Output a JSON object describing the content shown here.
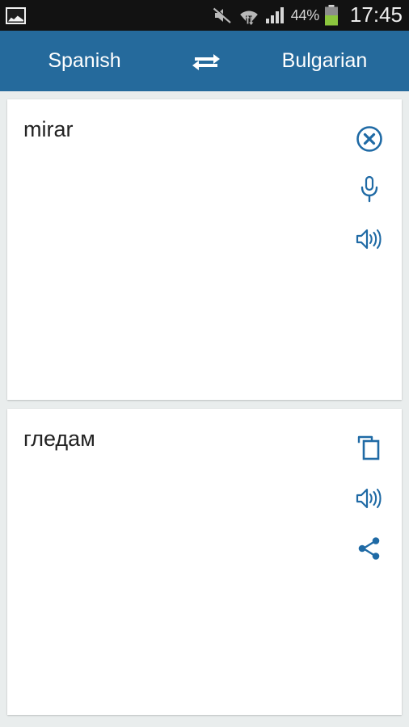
{
  "status_bar": {
    "left_icons": [
      {
        "name": "gallery-image-icon",
        "label": "image"
      }
    ],
    "right_icons": [
      {
        "name": "sound-muted-icon",
        "label": "mute"
      },
      {
        "name": "wifi-icon",
        "label": "wifi"
      },
      {
        "name": "cellular-signal-icon",
        "label": "signal"
      }
    ],
    "battery_percent": "44%",
    "battery_level": 44,
    "clock": "17:45",
    "background_color": "#121212",
    "text_color": "#d6d6d6"
  },
  "app_bar": {
    "source_language": "Spanish",
    "target_language": "Bulgarian",
    "swap_icon": "swap-horizontal-icon",
    "background_color": "#256a9c",
    "text_color": "#ffffff"
  },
  "source_card": {
    "text": "mirar",
    "actions": [
      {
        "name": "clear-button",
        "icon": "close-circle-icon",
        "label": "Clear"
      },
      {
        "name": "voice-input-button",
        "icon": "microphone-icon",
        "label": "Speak"
      },
      {
        "name": "speak-source-button",
        "icon": "volume-speaker-icon",
        "label": "Listen"
      }
    ]
  },
  "target_card": {
    "text": "гледам",
    "actions": [
      {
        "name": "copy-button",
        "icon": "copy-icon",
        "label": "Copy"
      },
      {
        "name": "speak-target-button",
        "icon": "volume-speaker-icon",
        "label": "Listen"
      },
      {
        "name": "share-button",
        "icon": "share-icon",
        "label": "Share"
      }
    ]
  },
  "theme": {
    "accent_blue": "#256a9c",
    "icon_blue": "#1f6aa5",
    "page_background": "#e9eded",
    "card_background": "#ffffff"
  }
}
